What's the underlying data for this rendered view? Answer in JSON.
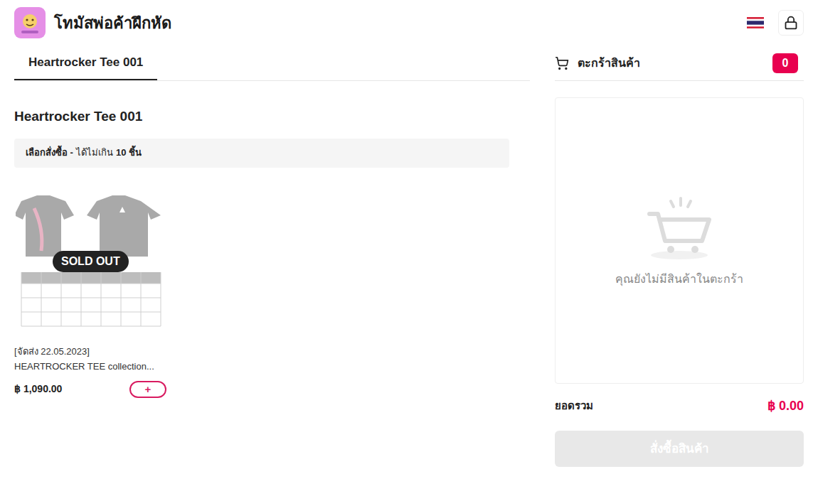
{
  "header": {
    "title": "โทมัสพ่อค้าฝึกหัด"
  },
  "tabs": [
    {
      "label": "Heartrocker Tee 001",
      "selected": true
    }
  ],
  "section": {
    "title": "Heartrocker Tee 001",
    "notice_label": "เลือกสั่งซื้อ -",
    "notice_text": "ได้ไม่เกิน",
    "notice_limit": "10 ชิ้น"
  },
  "products": [
    {
      "note": "[จัดส่ง 22.05.2023]",
      "name": "HEARTROCKER TEE collection...",
      "price": "฿ 1,090.00",
      "badge": "SOLD OUT",
      "add_button": "+",
      "sold_out": true
    }
  ],
  "cart": {
    "title": "ตะกร้าสินค้า",
    "count": "0",
    "empty_message": "คุณยังไม่มีสินค้าในตะกร้า",
    "total_label": "ยอดรวม",
    "total": "฿ 0.00",
    "checkout_button": "สั่งซื้อสินค้า",
    "checkout_disabled": true
  }
}
